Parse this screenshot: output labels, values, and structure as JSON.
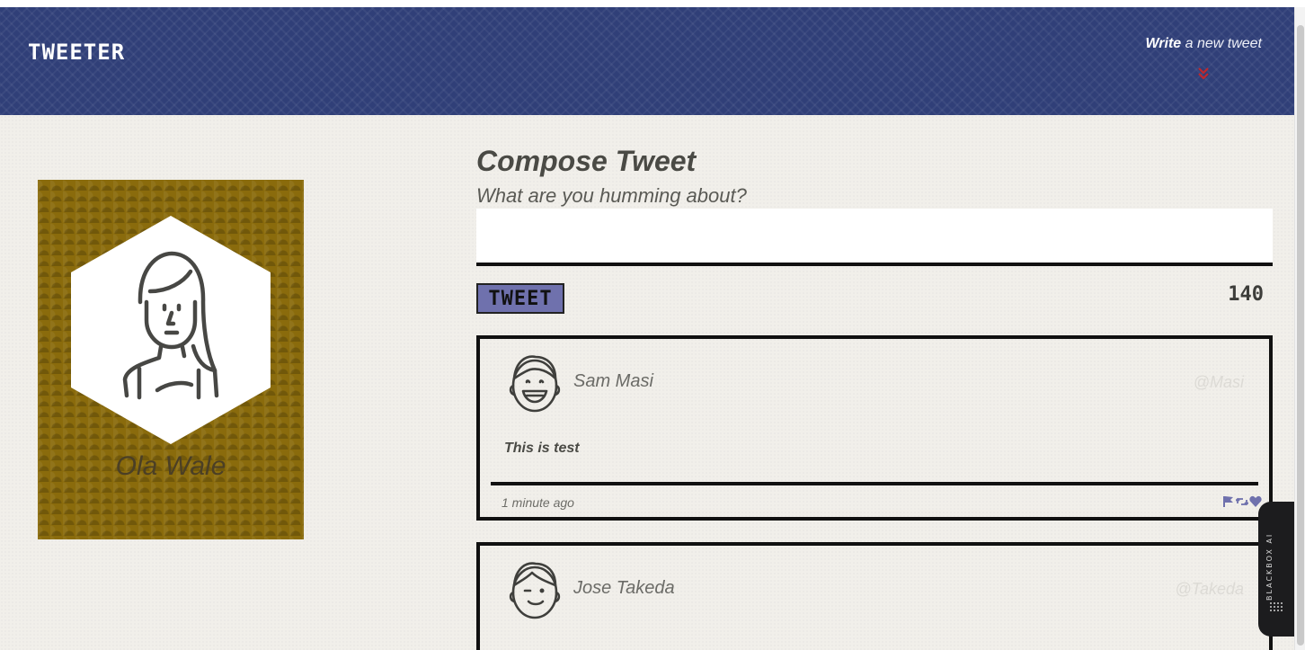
{
  "navbar": {
    "brand": "TWEETER",
    "compose_link_bold": "Write",
    "compose_link_rest": " a new tweet",
    "background_color": "#303f78",
    "chevron_color": "#c0272d"
  },
  "profile": {
    "name": "Ola Wale",
    "card_color": "#8a6b0c",
    "avatar_icon": "female-avatar-icon"
  },
  "compose": {
    "title": "Compose Tweet",
    "prompt": "What are you humming about?",
    "input_value": "",
    "button_label": "TWEET",
    "button_color": "#6f71ad",
    "char_count": "140"
  },
  "tweets": [
    {
      "author": "Sam Masi",
      "handle": "@Masi",
      "body": "This is test",
      "time": "1 minute ago",
      "avatar_icon": "smiling-man-avatar-icon",
      "actions": [
        "flag-icon",
        "retweet-icon",
        "heart-icon"
      ],
      "action_color": "#6f71ad"
    },
    {
      "author": "Jose Takeda",
      "handle": "@Takeda",
      "body": "",
      "time": "",
      "avatar_icon": "winking-man-avatar-icon"
    }
  ],
  "widget": {
    "label": "BLACKBOX AI"
  }
}
